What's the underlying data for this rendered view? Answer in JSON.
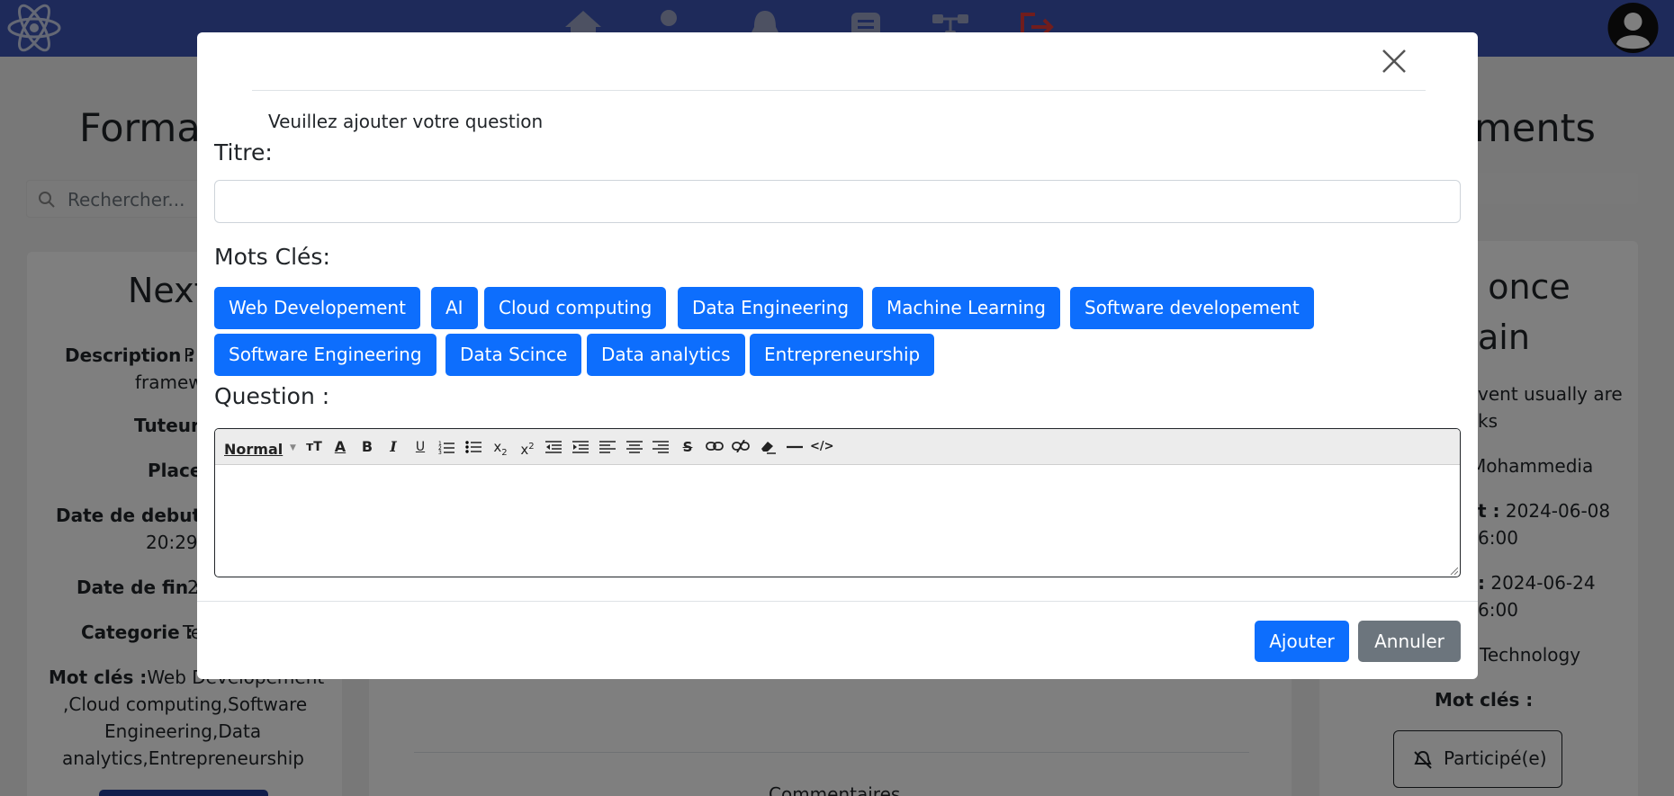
{
  "background": {
    "left_title": "Forma",
    "right_title": "ments",
    "search_placeholder": "Rechercher...",
    "left_card": {
      "title": "Next",
      "description_label": "Description :",
      "description_value": "P",
      "description_line2": "framew",
      "tuteur_label": "Tuteur",
      "place_label": "Place",
      "date_debut_label": "Date de debut",
      "date_debut_value": "20:29:",
      "date_fin_label": "Date de fin :",
      "date_fin_value": "2",
      "categorie_label": "Categorie :",
      "categorie_value": "Te",
      "mots_cles_label": "Mot clés :",
      "mots_cles_line1": "Web Developement",
      "mots_cles_line2": ",Cloud computing,Software",
      "mots_cles_line3": "Engineering,Data",
      "mots_cles_line4": "analytics,Entrepreneurship"
    },
    "right_card": {
      "title_line1": "g once",
      "title_line2": "ain",
      "desc_line1": "vent usually are",
      "desc_line2": "ks",
      "place": "Mohammedia",
      "date_debut_label": "t :",
      "date_debut_value": "2024-06-08",
      "date_debut_time": "6:00",
      "date_fin_label": ":",
      "date_fin_value": "2024-06-24",
      "date_fin_time": "6:00",
      "categorie": "Technology",
      "mots_cles_label": "Mot clés :",
      "participe_button": "Participé(e)"
    },
    "center_bottom_text": "Commentaires"
  },
  "modal": {
    "prompt": "Veuillez ajouter votre question",
    "titre_label": "Titre:",
    "titre_value": "",
    "mots_cles_label": "Mots Clés:",
    "tags": [
      "Web Developement",
      "AI",
      "Cloud computing",
      "Data Engineering",
      "Machine Learning",
      "Software developement",
      "Software Engineering",
      "Data Scince",
      "Data analytics",
      "Entrepreneurship"
    ],
    "question_label": "Question :",
    "editor": {
      "format_select": "Normal",
      "content": ""
    },
    "ajouter_button": "Ajouter",
    "annuler_button": "Annuler"
  },
  "colors": {
    "navbar": "#3d54b4",
    "primary": "#0d6efd",
    "secondary": "#6c757d",
    "logout_icon": "#e23b3b"
  },
  "icons": [
    "atom-logo-icon",
    "home-icon",
    "user-icon",
    "bell-icon",
    "chat-icon",
    "network-icon",
    "logout-icon",
    "avatar-icon",
    "close-icon",
    "search-icon",
    "bell-off-icon"
  ]
}
